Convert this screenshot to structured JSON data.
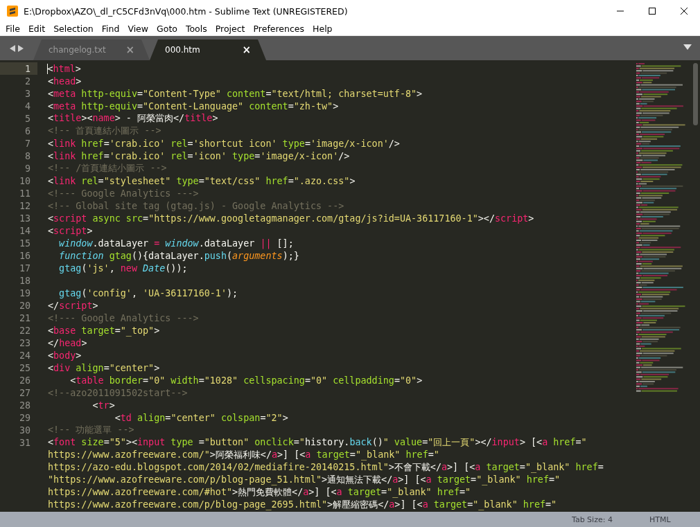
{
  "window": {
    "title": "E:\\Dropbox\\AZO\\_dl_rC5CFd3nVq\\000.htm - Sublime Text (UNREGISTERED)"
  },
  "menu": [
    "File",
    "Edit",
    "Selection",
    "Find",
    "View",
    "Goto",
    "Tools",
    "Project",
    "Preferences",
    "Help"
  ],
  "tabs": [
    {
      "label": "changelog.txt",
      "close": "×",
      "selected": false
    },
    {
      "label": "000.htm",
      "close": "×",
      "selected": true
    }
  ],
  "editor": {
    "lines": [
      {
        "number": "1",
        "current": true,
        "tokens": [
          {
            "kind": "punct",
            "text": "<"
          },
          {
            "kind": "tag",
            "text": "html"
          },
          {
            "kind": "punct",
            "text": ">"
          }
        ]
      },
      {
        "number": "2",
        "current": false,
        "tokens": [
          {
            "kind": "punct",
            "text": "<"
          },
          {
            "kind": "tag",
            "text": "head"
          },
          {
            "kind": "punct",
            "text": ">"
          }
        ]
      },
      {
        "number": "3",
        "current": false,
        "tokens": [
          {
            "kind": "punct",
            "text": "<"
          },
          {
            "kind": "tag",
            "text": "meta"
          },
          {
            "kind": "attr",
            "text": " http-equiv"
          },
          {
            "kind": "punct",
            "text": "="
          },
          {
            "kind": "string",
            "text": "\"Content-Type\""
          },
          {
            "kind": "attr",
            "text": " content"
          },
          {
            "kind": "punct",
            "text": "="
          },
          {
            "kind": "string",
            "text": "\"text/html; charset=utf-8\""
          },
          {
            "kind": "punct",
            "text": ">"
          }
        ]
      },
      {
        "number": "4",
        "current": false,
        "tokens": [
          {
            "kind": "punct",
            "text": "<"
          },
          {
            "kind": "tag",
            "text": "meta"
          },
          {
            "kind": "attr",
            "text": " http-equiv"
          },
          {
            "kind": "punct",
            "text": "="
          },
          {
            "kind": "string",
            "text": "\"Content-Language\""
          },
          {
            "kind": "attr",
            "text": " content"
          },
          {
            "kind": "punct",
            "text": "="
          },
          {
            "kind": "string",
            "text": "\"zh-tw\""
          },
          {
            "kind": "punct",
            "text": ">"
          }
        ]
      },
      {
        "number": "5",
        "current": false,
        "tokens": [
          {
            "kind": "punct",
            "text": "<"
          },
          {
            "kind": "tag",
            "text": "title"
          },
          {
            "kind": "punct",
            "text": "><"
          },
          {
            "kind": "tag",
            "text": "name"
          },
          {
            "kind": "punct",
            "text": "> - 阿榮當肉</"
          },
          {
            "kind": "tag",
            "text": "title"
          },
          {
            "kind": "punct",
            "text": ">"
          }
        ]
      },
      {
        "number": "6",
        "current": false,
        "tokens": [
          {
            "kind": "comment",
            "text": "<!-- 首頁連結小圖示 -->"
          }
        ]
      },
      {
        "number": "7",
        "current": false,
        "tokens": [
          {
            "kind": "punct",
            "text": "<"
          },
          {
            "kind": "tag",
            "text": "link"
          },
          {
            "kind": "attr",
            "text": " href"
          },
          {
            "kind": "punct",
            "text": "="
          },
          {
            "kind": "string",
            "text": "'crab.ico'"
          },
          {
            "kind": "attr",
            "text": " rel"
          },
          {
            "kind": "punct",
            "text": "="
          },
          {
            "kind": "string",
            "text": "'shortcut icon'"
          },
          {
            "kind": "attr",
            "text": " type"
          },
          {
            "kind": "punct",
            "text": "="
          },
          {
            "kind": "string",
            "text": "'image/x-icon'"
          },
          {
            "kind": "punct",
            "text": "/>"
          }
        ]
      },
      {
        "number": "8",
        "current": false,
        "tokens": [
          {
            "kind": "punct",
            "text": "<"
          },
          {
            "kind": "tag",
            "text": "link"
          },
          {
            "kind": "attr",
            "text": " href"
          },
          {
            "kind": "punct",
            "text": "="
          },
          {
            "kind": "string",
            "text": "'crab.ico'"
          },
          {
            "kind": "attr",
            "text": " rel"
          },
          {
            "kind": "punct",
            "text": "="
          },
          {
            "kind": "string",
            "text": "'icon'"
          },
          {
            "kind": "attr",
            "text": " type"
          },
          {
            "kind": "punct",
            "text": "="
          },
          {
            "kind": "string",
            "text": "'image/x-icon'"
          },
          {
            "kind": "punct",
            "text": "/>"
          }
        ]
      },
      {
        "number": "9",
        "current": false,
        "tokens": [
          {
            "kind": "comment",
            "text": "<!-- /首頁連結小圖示 -->"
          }
        ]
      },
      {
        "number": "10",
        "current": false,
        "tokens": [
          {
            "kind": "punct",
            "text": "<"
          },
          {
            "kind": "tag",
            "text": "link"
          },
          {
            "kind": "attr",
            "text": " rel"
          },
          {
            "kind": "punct",
            "text": "="
          },
          {
            "kind": "string",
            "text": "\"stylesheet\""
          },
          {
            "kind": "attr",
            "text": " type"
          },
          {
            "kind": "punct",
            "text": "="
          },
          {
            "kind": "string",
            "text": "\"text/css\""
          },
          {
            "kind": "attr",
            "text": " href"
          },
          {
            "kind": "punct",
            "text": "="
          },
          {
            "kind": "string",
            "text": "\".azo.css\""
          },
          {
            "kind": "punct",
            "text": ">"
          }
        ]
      },
      {
        "number": "11",
        "current": false,
        "tokens": [
          {
            "kind": "comment",
            "text": "<!--- Google Analytics --->"
          }
        ]
      },
      {
        "number": "12",
        "current": false,
        "tokens": [
          {
            "kind": "comment",
            "text": "<!-- Global site tag (gtag.js) - Google Analytics -->"
          }
        ]
      },
      {
        "number": "13",
        "current": false,
        "tokens": [
          {
            "kind": "punct",
            "text": "<"
          },
          {
            "kind": "tag",
            "text": "script"
          },
          {
            "kind": "attr",
            "text": " async"
          },
          {
            "kind": "attr",
            "text": " src"
          },
          {
            "kind": "punct",
            "text": "="
          },
          {
            "kind": "string",
            "text": "\"https://www.googletagmanager.com/gtag/js?id=UA-36117160-1\""
          },
          {
            "kind": "punct",
            "text": "></"
          },
          {
            "kind": "tag",
            "text": "script"
          },
          {
            "kind": "punct",
            "text": ">"
          }
        ]
      },
      {
        "number": "14",
        "current": false,
        "tokens": [
          {
            "kind": "punct",
            "text": "<"
          },
          {
            "kind": "tag",
            "text": "script"
          },
          {
            "kind": "punct",
            "text": ">"
          }
        ]
      },
      {
        "number": "15",
        "current": false,
        "tokens": [
          {
            "kind": "storage",
            "text": "  window"
          },
          {
            "kind": "punct",
            "text": ".dataLayer "
          },
          {
            "kind": "operator",
            "text": "="
          },
          {
            "kind": "storage",
            "text": " window"
          },
          {
            "kind": "punct",
            "text": ".dataLayer "
          },
          {
            "kind": "operator",
            "text": "||"
          },
          {
            "kind": "punct",
            "text": " [];"
          }
        ]
      },
      {
        "number": "16",
        "current": false,
        "tokens": [
          {
            "kind": "storage",
            "text": "  function"
          },
          {
            "kind": "attr",
            "text": " gtag"
          },
          {
            "kind": "punct",
            "text": "(){dataLayer."
          },
          {
            "kind": "call",
            "text": "push"
          },
          {
            "kind": "punct",
            "text": "("
          },
          {
            "kind": "param",
            "text": "arguments"
          },
          {
            "kind": "punct",
            "text": ");}"
          }
        ]
      },
      {
        "number": "17",
        "current": false,
        "tokens": [
          {
            "kind": "call",
            "text": "  gtag"
          },
          {
            "kind": "punct",
            "text": "("
          },
          {
            "kind": "string",
            "text": "'js'"
          },
          {
            "kind": "punct",
            "text": ", "
          },
          {
            "kind": "operator",
            "text": "new"
          },
          {
            "kind": "storage",
            "text": " Date"
          },
          {
            "kind": "punct",
            "text": "());"
          }
        ]
      },
      {
        "number": "18",
        "current": false
      },
      {
        "number": "19",
        "current": false,
        "tokens": [
          {
            "kind": "call",
            "text": "  gtag"
          },
          {
            "kind": "punct",
            "text": "("
          },
          {
            "kind": "string",
            "text": "'config'"
          },
          {
            "kind": "punct",
            "text": ", "
          },
          {
            "kind": "string",
            "text": "'UA-36117160-1'"
          },
          {
            "kind": "punct",
            "text": ");"
          }
        ]
      },
      {
        "number": "20",
        "current": false,
        "tokens": [
          {
            "kind": "punct",
            "text": "</"
          },
          {
            "kind": "tag",
            "text": "script"
          },
          {
            "kind": "punct",
            "text": ">"
          }
        ]
      },
      {
        "number": "21",
        "current": false,
        "tokens": [
          {
            "kind": "comment",
            "text": "<!--- Google Analytics --->"
          }
        ]
      },
      {
        "number": "22",
        "current": false,
        "tokens": [
          {
            "kind": "punct",
            "text": "<"
          },
          {
            "kind": "tag",
            "text": "base"
          },
          {
            "kind": "attr",
            "text": " target"
          },
          {
            "kind": "punct",
            "text": "="
          },
          {
            "kind": "string",
            "text": "\"_top\""
          },
          {
            "kind": "punct",
            "text": ">"
          }
        ]
      },
      {
        "number": "23",
        "current": false,
        "tokens": [
          {
            "kind": "punct",
            "text": "</"
          },
          {
            "kind": "tag",
            "text": "head"
          },
          {
            "kind": "punct",
            "text": ">"
          }
        ]
      },
      {
        "number": "24",
        "current": false,
        "tokens": [
          {
            "kind": "punct",
            "text": "<"
          },
          {
            "kind": "tag",
            "text": "body"
          },
          {
            "kind": "punct",
            "text": ">"
          }
        ]
      },
      {
        "number": "25",
        "current": false,
        "tokens": [
          {
            "kind": "punct",
            "text": "<"
          },
          {
            "kind": "tag",
            "text": "div"
          },
          {
            "kind": "attr",
            "text": " align"
          },
          {
            "kind": "punct",
            "text": "="
          },
          {
            "kind": "string",
            "text": "\"center\""
          },
          {
            "kind": "punct",
            "text": ">"
          }
        ]
      },
      {
        "number": "26",
        "current": false,
        "tokens": [
          {
            "kind": "punct",
            "text": "    <"
          },
          {
            "kind": "tag",
            "text": "table"
          },
          {
            "kind": "attr",
            "text": " border"
          },
          {
            "kind": "punct",
            "text": "="
          },
          {
            "kind": "string",
            "text": "\"0\""
          },
          {
            "kind": "attr",
            "text": " width"
          },
          {
            "kind": "punct",
            "text": "="
          },
          {
            "kind": "string",
            "text": "\"1028\""
          },
          {
            "kind": "attr",
            "text": " cellspacing"
          },
          {
            "kind": "punct",
            "text": "="
          },
          {
            "kind": "string",
            "text": "\"0\""
          },
          {
            "kind": "attr",
            "text": " cellpadding"
          },
          {
            "kind": "punct",
            "text": "="
          },
          {
            "kind": "string",
            "text": "\"0\""
          },
          {
            "kind": "punct",
            "text": ">"
          }
        ]
      },
      {
        "number": "27",
        "current": false,
        "tokens": [
          {
            "kind": "comment",
            "text": "<!--azo2011091502start-->"
          }
        ]
      },
      {
        "number": "28",
        "current": false,
        "tokens": [
          {
            "kind": "punct",
            "text": "        <"
          },
          {
            "kind": "tag",
            "text": "tr"
          },
          {
            "kind": "punct",
            "text": ">"
          }
        ]
      },
      {
        "number": "29",
        "current": false,
        "tokens": [
          {
            "kind": "punct",
            "text": "            <"
          },
          {
            "kind": "tag",
            "text": "td"
          },
          {
            "kind": "attr",
            "text": " align"
          },
          {
            "kind": "punct",
            "text": "="
          },
          {
            "kind": "string",
            "text": "\"center\""
          },
          {
            "kind": "attr",
            "text": " colspan"
          },
          {
            "kind": "punct",
            "text": "="
          },
          {
            "kind": "string",
            "text": "\"2\""
          },
          {
            "kind": "punct",
            "text": ">"
          }
        ]
      },
      {
        "number": "30",
        "current": false,
        "tokens": [
          {
            "kind": "comment",
            "text": "<!-- 功能選單 -->"
          }
        ]
      },
      {
        "number": "31",
        "current": false,
        "tokens": [
          {
            "kind": "punct",
            "text": "<"
          },
          {
            "kind": "tag",
            "text": "font"
          },
          {
            "kind": "attr",
            "text": " size"
          },
          {
            "kind": "punct",
            "text": "="
          },
          {
            "kind": "string",
            "text": "\"5\""
          },
          {
            "kind": "punct",
            "text": "><"
          },
          {
            "kind": "tag",
            "text": "input"
          },
          {
            "kind": "attr",
            "text": " type"
          },
          {
            "kind": "punct",
            "text": " ="
          },
          {
            "kind": "string",
            "text": "\"button\""
          },
          {
            "kind": "attr",
            "text": " onclick"
          },
          {
            "kind": "punct",
            "text": "="
          },
          {
            "kind": "string",
            "text": "\""
          },
          {
            "kind": "punct",
            "text": "history."
          },
          {
            "kind": "call",
            "text": "back"
          },
          {
            "kind": "punct",
            "text": "()"
          },
          {
            "kind": "string",
            "text": "\""
          },
          {
            "kind": "attr",
            "text": " value"
          },
          {
            "kind": "punct",
            "text": "="
          },
          {
            "kind": "string",
            "text": "\"回上一頁\""
          },
          {
            "kind": "punct",
            "text": "></"
          },
          {
            "kind": "tag",
            "text": "input"
          },
          {
            "kind": "punct",
            "text": "> [<"
          },
          {
            "kind": "tag",
            "text": "a"
          },
          {
            "kind": "attr",
            "text": " href"
          },
          {
            "kind": "punct",
            "text": "="
          },
          {
            "kind": "string",
            "text": "\""
          }
        ]
      },
      {
        "current": false,
        "tokens": [
          {
            "kind": "string",
            "text": "https://www.azofreeware.com/\""
          },
          {
            "kind": "punct",
            "text": ">阿榮福利味</"
          },
          {
            "kind": "tag",
            "text": "a"
          },
          {
            "kind": "punct",
            "text": ">] [<"
          },
          {
            "kind": "tag",
            "text": "a"
          },
          {
            "kind": "attr",
            "text": " target"
          },
          {
            "kind": "punct",
            "text": "="
          },
          {
            "kind": "string",
            "text": "\"_blank\""
          },
          {
            "kind": "attr",
            "text": " href"
          },
          {
            "kind": "punct",
            "text": "="
          },
          {
            "kind": "string",
            "text": "\""
          }
        ]
      },
      {
        "current": false,
        "tokens": [
          {
            "kind": "string",
            "text": "https://azo-edu.blogspot.com/2014/02/mediafire-20140215.html\""
          },
          {
            "kind": "punct",
            "text": ">不會下載</"
          },
          {
            "kind": "tag",
            "text": "a"
          },
          {
            "kind": "punct",
            "text": ">] [<"
          },
          {
            "kind": "tag",
            "text": "a"
          },
          {
            "kind": "attr",
            "text": " target"
          },
          {
            "kind": "punct",
            "text": "="
          },
          {
            "kind": "string",
            "text": "\"_blank\""
          },
          {
            "kind": "attr",
            "text": " href"
          },
          {
            "kind": "punct",
            "text": "="
          }
        ]
      },
      {
        "current": false,
        "tokens": [
          {
            "kind": "string",
            "text": "\"https://www.azofreeware.com/p/blog-page_51.html\""
          },
          {
            "kind": "punct",
            "text": ">通知無法下載</"
          },
          {
            "kind": "tag",
            "text": "a"
          },
          {
            "kind": "punct",
            "text": ">] [<"
          },
          {
            "kind": "tag",
            "text": "a"
          },
          {
            "kind": "attr",
            "text": " target"
          },
          {
            "kind": "punct",
            "text": "="
          },
          {
            "kind": "string",
            "text": "\"_blank\""
          },
          {
            "kind": "attr",
            "text": " href"
          },
          {
            "kind": "punct",
            "text": "="
          },
          {
            "kind": "string",
            "text": "\""
          }
        ]
      },
      {
        "current": false,
        "tokens": [
          {
            "kind": "string",
            "text": "https://www.azofreeware.com/#hot\""
          },
          {
            "kind": "punct",
            "text": ">熱門免費軟體</"
          },
          {
            "kind": "tag",
            "text": "a"
          },
          {
            "kind": "punct",
            "text": ">] [<"
          },
          {
            "kind": "tag",
            "text": "a"
          },
          {
            "kind": "attr",
            "text": " target"
          },
          {
            "kind": "punct",
            "text": "="
          },
          {
            "kind": "string",
            "text": "\"_blank\""
          },
          {
            "kind": "attr",
            "text": " href"
          },
          {
            "kind": "punct",
            "text": "="
          },
          {
            "kind": "string",
            "text": "\""
          }
        ]
      },
      {
        "current": false,
        "tokens": [
          {
            "kind": "string",
            "text": "https://www.azofreeware.com/p/blog-page_2695.html\""
          },
          {
            "kind": "punct",
            "text": ">解壓縮密碼</"
          },
          {
            "kind": "tag",
            "text": "a"
          },
          {
            "kind": "punct",
            "text": ">] [<"
          },
          {
            "kind": "tag",
            "text": "a"
          },
          {
            "kind": "attr",
            "text": " target"
          },
          {
            "kind": "punct",
            "text": "="
          },
          {
            "kind": "string",
            "text": "\"_blank\""
          },
          {
            "kind": "attr",
            "text": " href"
          },
          {
            "kind": "punct",
            "text": "="
          },
          {
            "kind": "string",
            "text": "\""
          }
        ]
      }
    ]
  },
  "status_bar": {
    "tab_size": "Tab Size: 4",
    "syntax": "HTML"
  }
}
